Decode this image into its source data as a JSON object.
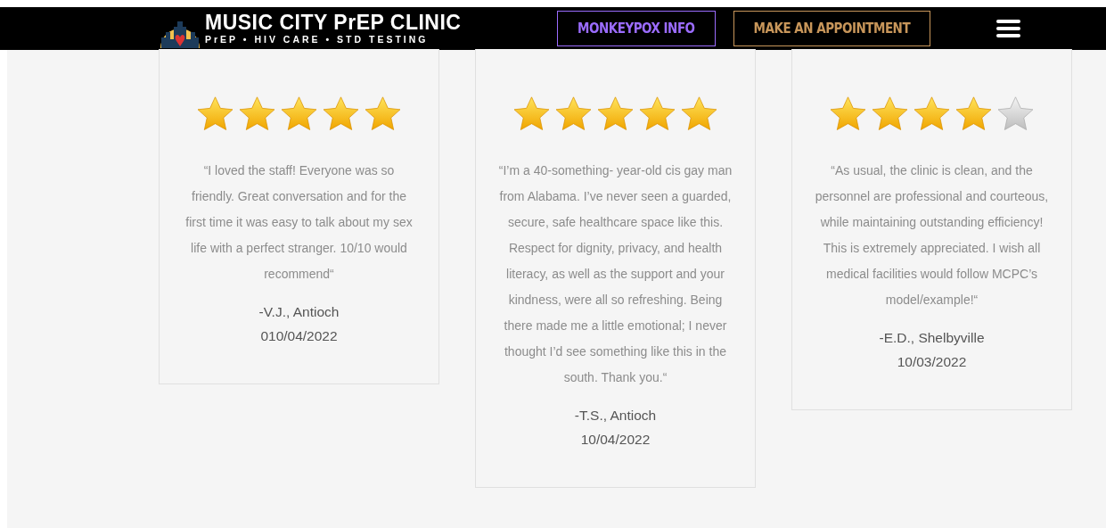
{
  "header": {
    "logo_title": "MUSIC CITY PrEP CLINIC",
    "logo_tagline": "PrEP • HIV CARE • STD TESTING",
    "buttons": [
      {
        "label": "MONKEYPOX INFO",
        "color": "#9b6cff"
      },
      {
        "label": "MAKE AN APPOINTMENT",
        "color": "#c8965a"
      }
    ]
  },
  "reviews": [
    {
      "stars": 5,
      "quote": "“I loved the staff! Everyone was so friendly. Great conversation and for the first time it was easy to talk about my sex life with a perfect stranger. 10/10 would recommend“",
      "author": "-V.J., Antioch",
      "date": "010/04/2022"
    },
    {
      "stars": 5,
      "quote": "“I’m a 40-something- year-old cis gay man from Alabama. I’ve never seen a guarded, secure, safe healthcare space like this. Respect for dignity, privacy, and health literacy, as well as the support and your kindness, were all so refreshing. Being there made me a little emotional; I never thought I’d see something like this in the south. Thank you.“",
      "author": "-T.S., Antioch",
      "date": "10/04/2022"
    },
    {
      "stars": 4,
      "quote": "“As usual, the clinic is clean, and the personnel are professional and courteous, while maintaining outstanding efficiency! This is extremely appreciated. I wish all medical facilities would follow MCPC’s model/example!“",
      "author": "-E.D., Shelbyville",
      "date": "10/03/2022"
    }
  ]
}
